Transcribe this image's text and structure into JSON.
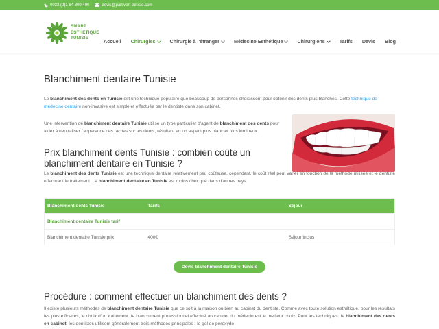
{
  "topbar": {
    "phone": "0033 (0)1 84 800 400",
    "email": "devis@partivert-tunisie.com"
  },
  "logo": {
    "line1": "SMART",
    "line2": "ESTHETIQUE",
    "line3": "TUNISIE"
  },
  "nav": {
    "items": [
      {
        "label": "Accueil",
        "dropdown": false,
        "active": false
      },
      {
        "label": "Chirurgies",
        "dropdown": true,
        "active": true
      },
      {
        "label": "Chirurgie à l'étranger",
        "dropdown": true,
        "active": false
      },
      {
        "label": "Médecine Esthétique",
        "dropdown": true,
        "active": false
      },
      {
        "label": "Chirurgiens",
        "dropdown": true,
        "active": false
      },
      {
        "label": "Tarifs",
        "dropdown": false,
        "active": false
      },
      {
        "label": "Devis",
        "dropdown": false,
        "active": false
      },
      {
        "label": "Blog",
        "dropdown": false,
        "active": false
      }
    ]
  },
  "page": {
    "title": "Blanchiment dentaire Tunisie",
    "p1": {
      "t1": "Le ",
      "b1": "blanchiment des dents en Tunisie",
      "t2": " est une technique populaire que beaucoup de personnes choisissent pour obtenir des dents plus blanches. Cette ",
      "link": "technique de médecine dentaire",
      "t3": " non-invasive est simple et effectuée par le dentiste dans son cabinet."
    },
    "p2": {
      "t1": "Une intervention de ",
      "b1": "blanchiment dentaire Tunisie",
      "t2": " utilise un type particulier d'agent de ",
      "b2": "blanchiment des dents",
      "t3": " pour aider à neutraliser l'apparence des taches sur les dents, résultant en un aspect plus blanc et plus lumineux."
    },
    "h2a": "Prix blanchiment dents Tunisie : combien coûte un blanchiment dentaire en Tunisie ?",
    "p3": {
      "t1": "Le ",
      "b1": "blanchiment des dents Tunisie",
      "t2": " est une technique dentaire relativement peu coûteuse, cependant, le coût réel peut varier en fonction de la méthode utilisée et le dentiste effectuant le traitement. Le ",
      "b2": "blanchiment dentaire en Tunisie",
      "t3": " est moins cher que dans d'autres pays."
    },
    "table": {
      "headers": [
        "Blanchiment dents Tunisie",
        "Tarifs",
        "Séjour"
      ],
      "subheader": "Blanchiment dentaire Tunisie tarif",
      "rows": [
        [
          "Blanchiment dentaire Tunisie prix",
          "400€",
          "Séjour inclus"
        ]
      ]
    },
    "cta": "Devis blanchiment dentaire Tunisie",
    "h2b": "Procédure : comment effectuer un blanchiment des dents ?",
    "p4": {
      "t1": "Il existe plusieurs méthodes de ",
      "b1": "blanchiment dentaire Tunisie",
      "t2": " que ce soit à la maison ou bien au cabinet du dentiste. Comme avec toute solution esthétique, pour les résultats les plus efficaces, le choix d'un traitement de blanchiment professionnel effectué au cabinet du médecin est le meilleur choix. Pour les techniques de ",
      "b2": "blanchiment des dents en cabinet",
      "t3": ", les dentistes utilisent généralement trois méthodes principales : le gel de peroxyde"
    }
  },
  "colors": {
    "brand_green": "#6dbd4e",
    "link_blue": "#2ea3f2"
  },
  "icons": {
    "phone": "phone-icon",
    "email": "envelope-icon"
  }
}
